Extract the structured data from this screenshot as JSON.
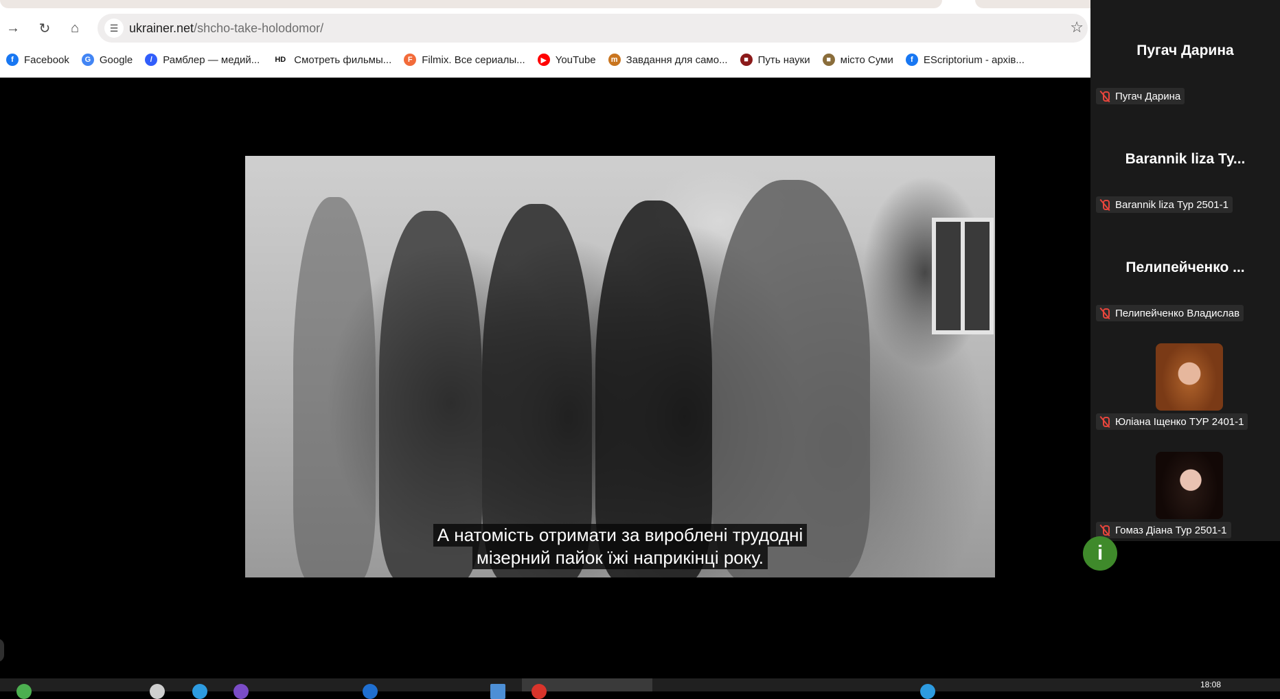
{
  "browser": {
    "url_host": "ukrainer.net",
    "url_path": "/shcho-take-holodomor/",
    "bookmarks": [
      {
        "label": "Facebook",
        "icon": "facebook-icon",
        "color": "#1877f2",
        "glyph": "f"
      },
      {
        "label": "Google",
        "icon": "google-icon",
        "color": "#4285f4",
        "glyph": "G"
      },
      {
        "label": "Рамблер — медий...",
        "icon": "rambler-icon",
        "color": "#315efb",
        "glyph": "/"
      },
      {
        "label": "Смотреть фильмы...",
        "icon": "hd-icon",
        "color": "#111111",
        "glyph": "HD"
      },
      {
        "label": "Filmix. Все сериалы...",
        "icon": "filmix-icon",
        "color": "#f26b3a",
        "glyph": "F"
      },
      {
        "label": "YouTube",
        "icon": "youtube-icon",
        "color": "#ff0000",
        "glyph": "▶"
      },
      {
        "label": "Завдання для само...",
        "icon": "tasks-icon",
        "color": "#c9751f",
        "glyph": "m"
      },
      {
        "label": "Путь науки",
        "icon": "book-icon",
        "color": "#8b1a1a",
        "glyph": "■"
      },
      {
        "label": "місто Суми",
        "icon": "sumy-icon",
        "color": "#8a6d3b",
        "glyph": "■"
      },
      {
        "label": "EScriptorium - архів...",
        "icon": "escriptorium-icon",
        "color": "#1877f2",
        "glyph": "f"
      }
    ]
  },
  "video": {
    "subtitle_line1": "А натомість отримати за вироблені трудодні",
    "subtitle_line2": "мізерний пайок їжі наприкінці року."
  },
  "participants": [
    {
      "display_name": "Пугач Дарина",
      "label": "Пугач Дарина",
      "has_video": false
    },
    {
      "display_name": "Barannik liza Ту...",
      "label": "Barannik liza Тур 2501-1",
      "has_video": false
    },
    {
      "display_name": "Пелипейченко ...",
      "label": "Пелипейченко Владислав",
      "has_video": false
    },
    {
      "display_name": "",
      "label": "Юліана Іщенко ТУР 2401-1",
      "has_video": true
    },
    {
      "display_name": "",
      "label": "Гомаз Діана Тур 2501-1",
      "has_video": true
    }
  ],
  "taskbar": {
    "clock": "18:08"
  },
  "info_button": {
    "glyph": "i"
  }
}
